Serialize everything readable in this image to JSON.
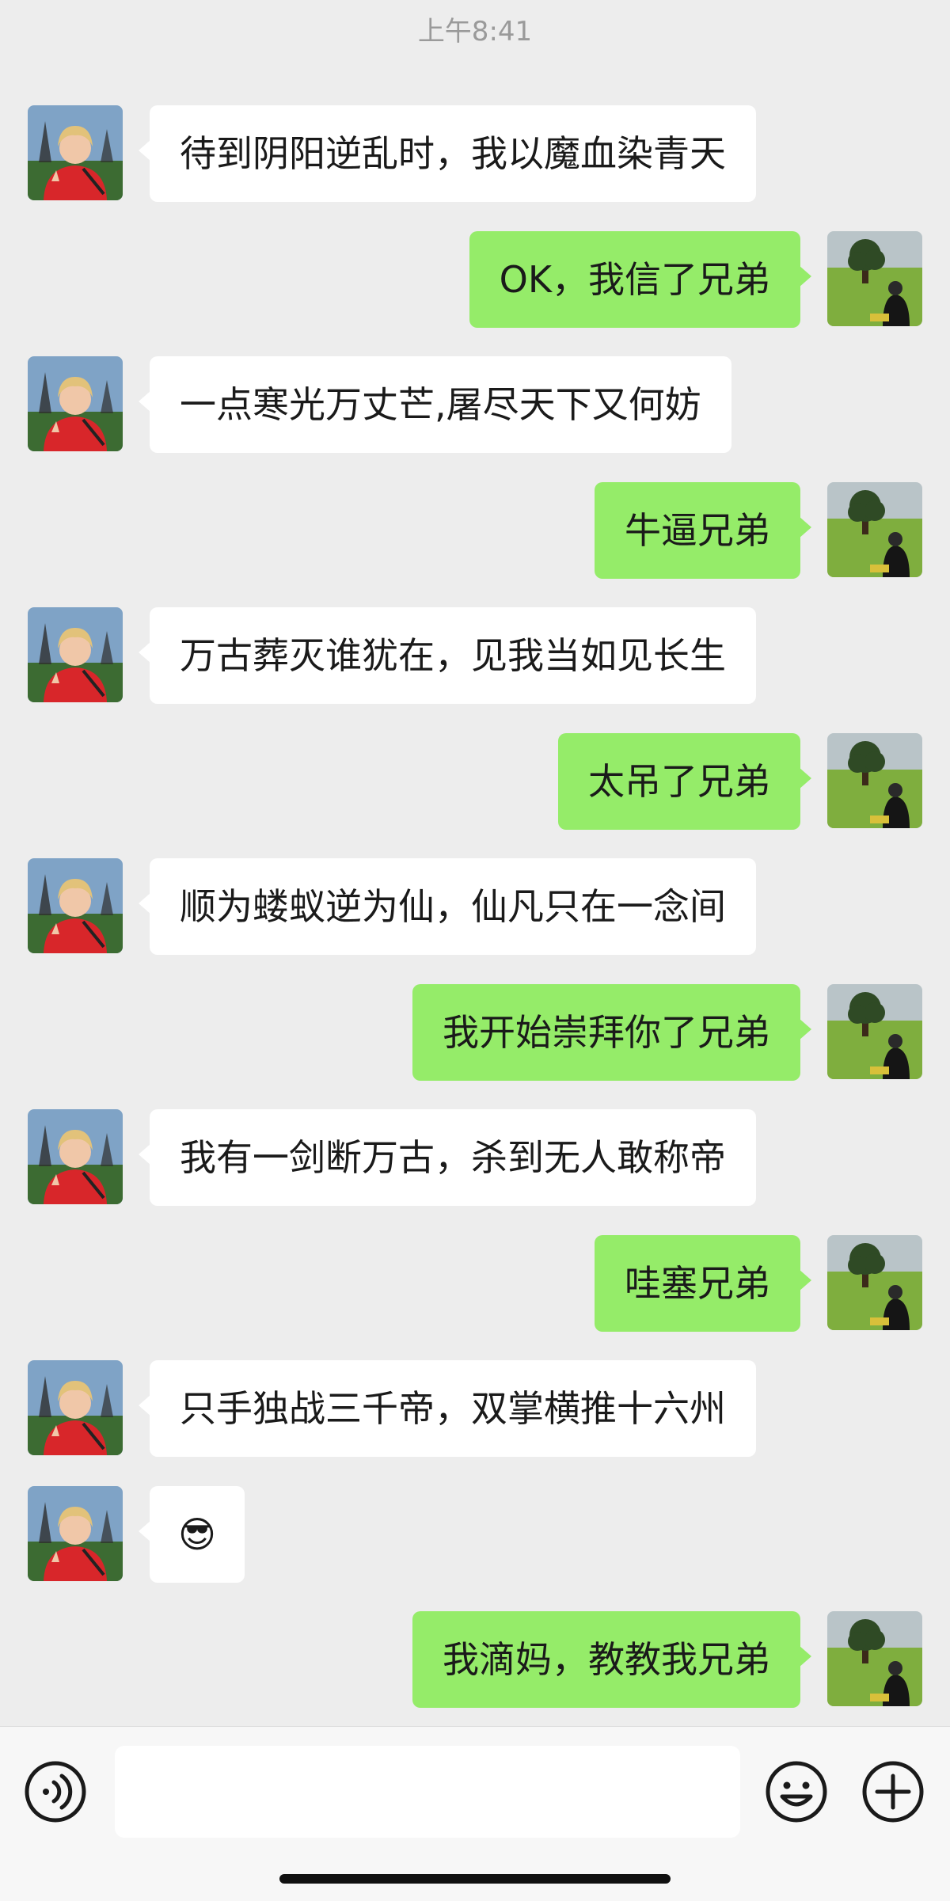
{
  "status": {
    "time": "上午8:41"
  },
  "theme": {
    "background": "#ededed",
    "incoming_bubble": "#ffffff",
    "outgoing_bubble": "#95ec69"
  },
  "messages": [
    {
      "side": "left",
      "text": "待到阴阳逆乱时，我以魔血染青天"
    },
    {
      "side": "right",
      "text": "OK，我信了兄弟"
    },
    {
      "side": "left",
      "text": "一点寒光万丈芒,屠尽天下又何妨"
    },
    {
      "side": "right",
      "text": "牛逼兄弟"
    },
    {
      "side": "left",
      "text": "万古葬灭谁犹在，见我当如见长生"
    },
    {
      "side": "right",
      "text": "太吊了兄弟"
    },
    {
      "side": "left",
      "text": "顺为蝼蚁逆为仙，仙凡只在一念间"
    },
    {
      "side": "right",
      "text": "我开始崇拜你了兄弟"
    },
    {
      "side": "left",
      "text": "我有一剑断万古，杀到无人敢称帝"
    },
    {
      "side": "right",
      "text": "哇塞兄弟"
    },
    {
      "side": "left",
      "text": "只手独战三千帝，双掌横推十六州"
    },
    {
      "side": "left",
      "text": "😎",
      "emoji": true
    },
    {
      "side": "right",
      "text": "我滴妈，教教我兄弟"
    }
  ],
  "input_bar": {
    "voice_icon": "voice-icon",
    "emoji_icon": "smiley-icon",
    "plus_icon": "plus-icon",
    "text_value": ""
  }
}
